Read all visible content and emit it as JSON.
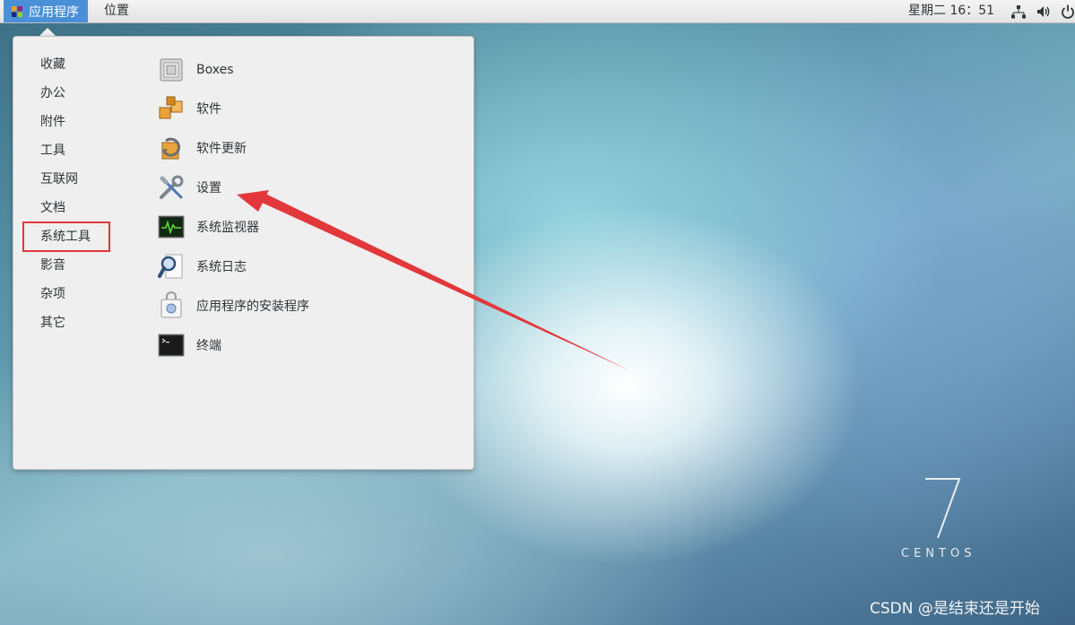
{
  "topbar": {
    "apps_label": "应用程序",
    "places_label": "位置",
    "clock": "星期二 16：51",
    "icons": [
      "app-logo-icon",
      "network-icon",
      "volume-icon",
      "power-icon"
    ]
  },
  "menu": {
    "categories": [
      "收藏",
      "办公",
      "附件",
      "工具",
      "互联网",
      "文档",
      "系统工具",
      "影音",
      "杂项",
      "其它"
    ],
    "selected_category": "系统工具",
    "apps": [
      "Boxes",
      "软件",
      "软件更新",
      "设置",
      "系统监视器",
      "系统日志",
      "应用程序的安装程序",
      "终端"
    ]
  },
  "desktop": {
    "brand_number": "7",
    "brand_text": "CENTOS",
    "watermark": "CSDN @是结束还是开始"
  },
  "colors": {
    "accent": "#4a90d9",
    "highlight_box": "#e2373b",
    "annotation_arrow": "#e2373b"
  }
}
